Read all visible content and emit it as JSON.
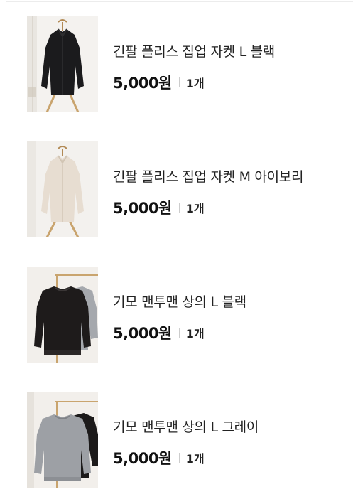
{
  "items": [
    {
      "name": "긴팔 플리스 집업 자켓 L 블랙",
      "price": "5,000원",
      "qty": "1개",
      "image": "black-fleece-zip-jacket",
      "color": "#1d1d1f"
    },
    {
      "name": "긴팔 플리스 집업 자켓 M 아이보리",
      "price": "5,000원",
      "qty": "1개",
      "image": "ivory-fleece-zip-jacket",
      "color": "#e6ddd2"
    },
    {
      "name": "기모 맨투맨 상의 L 블랙",
      "price": "5,000원",
      "qty": "1개",
      "image": "black-fleece-sweatshirt",
      "color": "#1e1b1b"
    },
    {
      "name": "기모 맨투맨 상의 L 그레이",
      "price": "5,000원",
      "qty": "1개",
      "image": "gray-fleece-sweatshirt",
      "color": "#9a9da3"
    }
  ]
}
